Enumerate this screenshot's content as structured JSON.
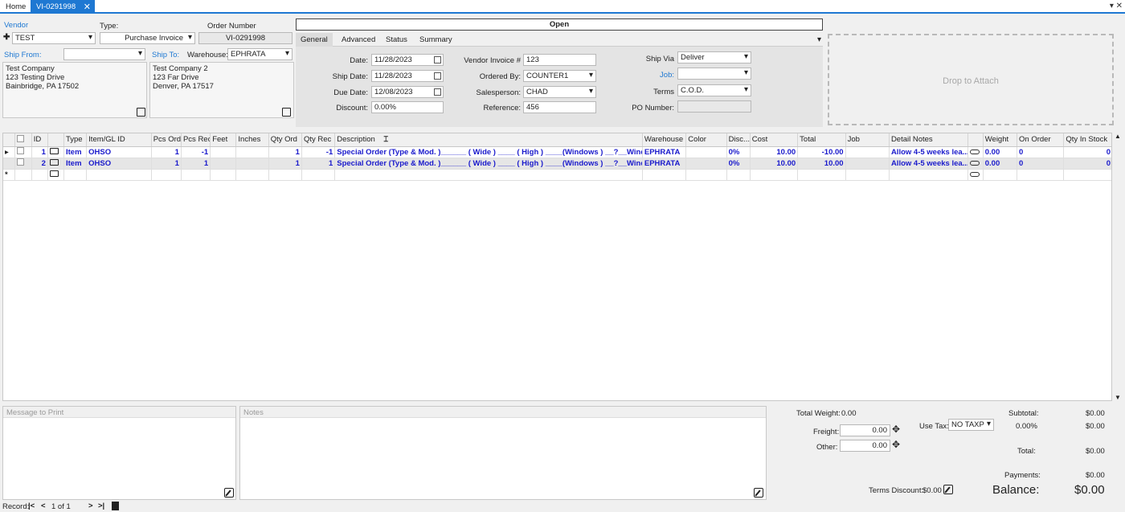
{
  "tabs": {
    "home": "Home",
    "active": "VI-0291998"
  },
  "header": {
    "vendor_label": "Vendor",
    "vendor_value": "TEST",
    "type_label": "Type:",
    "type_value": "Purchase Invoice",
    "order_number_label": "Order Number",
    "order_number_value": "VI-0291998",
    "ship_from_label": "Ship From:",
    "ship_from_value": "",
    "ship_to_label": "Ship To:",
    "warehouse_label": "Warehouse:",
    "warehouse_value": "EPHRATA",
    "ship_from_address": [
      "Test Company",
      "123 Testing Drive",
      "Bainbridge, PA 17502"
    ],
    "ship_to_address": [
      "Test Company 2",
      "123 Far Drive",
      "Denver, PA 17517"
    ]
  },
  "status": "Open",
  "subtabs": [
    "General",
    "Advanced",
    "Status",
    "Summary"
  ],
  "general": {
    "date_label": "Date:",
    "date_value": "11/28/2023",
    "ship_date_label": "Ship Date:",
    "ship_date_value": "11/28/2023",
    "due_date_label": "Due Date:",
    "due_date_value": "12/08/2023",
    "discount_label": "Discount:",
    "discount_value": "0.00%",
    "vendor_invoice_label": "Vendor Invoice #",
    "vendor_invoice_value": "123",
    "ordered_by_label": "Ordered By:",
    "ordered_by_value": "COUNTER1",
    "salesperson_label": "Salesperson:",
    "salesperson_value": "CHAD",
    "reference_label": "Reference:",
    "reference_value": "456",
    "ship_via_label": "Ship Via",
    "ship_via_value": "Deliver",
    "job_label": "Job:",
    "job_value": "",
    "terms_label": "Terms",
    "terms_value": "C.O.D.",
    "po_number_label": "PO Number:",
    "po_number_value": ""
  },
  "drop_label": "Drop to Attach",
  "grid": {
    "columns": [
      "",
      "ID",
      "",
      "Type",
      "Item/GL ID",
      "Pcs Ord",
      "Pcs Rec",
      "Feet",
      "Inches",
      "Qty Ord",
      "Qty Rec",
      "Description",
      "Warehouse",
      "Color",
      "Disc...",
      "Cost",
      "Total",
      "Job",
      "Detail Notes",
      "",
      "Weight",
      "On Order",
      "Qty In Stock"
    ],
    "rows": [
      {
        "id": "1",
        "type": "Item",
        "item": "OHSO",
        "pcs_ord": "1",
        "pcs_rec": "-1",
        "feet": "",
        "inches": "",
        "qty_ord": "1",
        "qty_rec": "-1",
        "desc": "Special  Order (Type & Mod. )______ ( Wide ) ____ ( High ) ____(Windows ) __?__Window Loca",
        "warehouse": "EPHRATA",
        "color": "",
        "disc": "0%",
        "cost": "10.00",
        "total": "-10.00",
        "job": "",
        "notes": "Allow 4-5 weeks lea...",
        "weight": "0.00",
        "on_order": "0",
        "in_stock": "0"
      },
      {
        "id": "2",
        "type": "Item",
        "item": "OHSO",
        "pcs_ord": "1",
        "pcs_rec": "1",
        "feet": "",
        "inches": "",
        "qty_ord": "1",
        "qty_rec": "1",
        "desc": "Special  Order (Type & Mod. )______ ( Wide ) ____ ( High ) ____(Windows ) __?__Window Loca",
        "warehouse": "EPHRATA",
        "color": "",
        "disc": "0%",
        "cost": "10.00",
        "total": "10.00",
        "job": "",
        "notes": "Allow 4-5 weeks lea...",
        "weight": "0.00",
        "on_order": "0",
        "in_stock": "0"
      }
    ]
  },
  "bottom": {
    "message_label": "Message to Print",
    "notes_label": "Notes",
    "total_weight_label": "Total Weight:",
    "total_weight_value": "0.00",
    "freight_label": "Freight:",
    "freight_value": "0.00",
    "other_label": "Other:",
    "other_value": "0.00",
    "use_tax_label": "Use Tax:",
    "use_tax_value": "NO TAXP",
    "subtotal_label": "Subtotal:",
    "subtotal_value": "$0.00",
    "tax_pct": "0.00%",
    "tax_value": "$0.00",
    "total_label": "Total:",
    "total_value": "$0.00",
    "payments_label": "Payments:",
    "payments_value": "$0.00",
    "terms_discount_label": "Terms Discount:",
    "terms_discount_value": "$0.00",
    "balance_label": "Balance:",
    "balance_value": "$0.00"
  },
  "record_nav": {
    "label": "Record:",
    "position": "1 of 1"
  }
}
